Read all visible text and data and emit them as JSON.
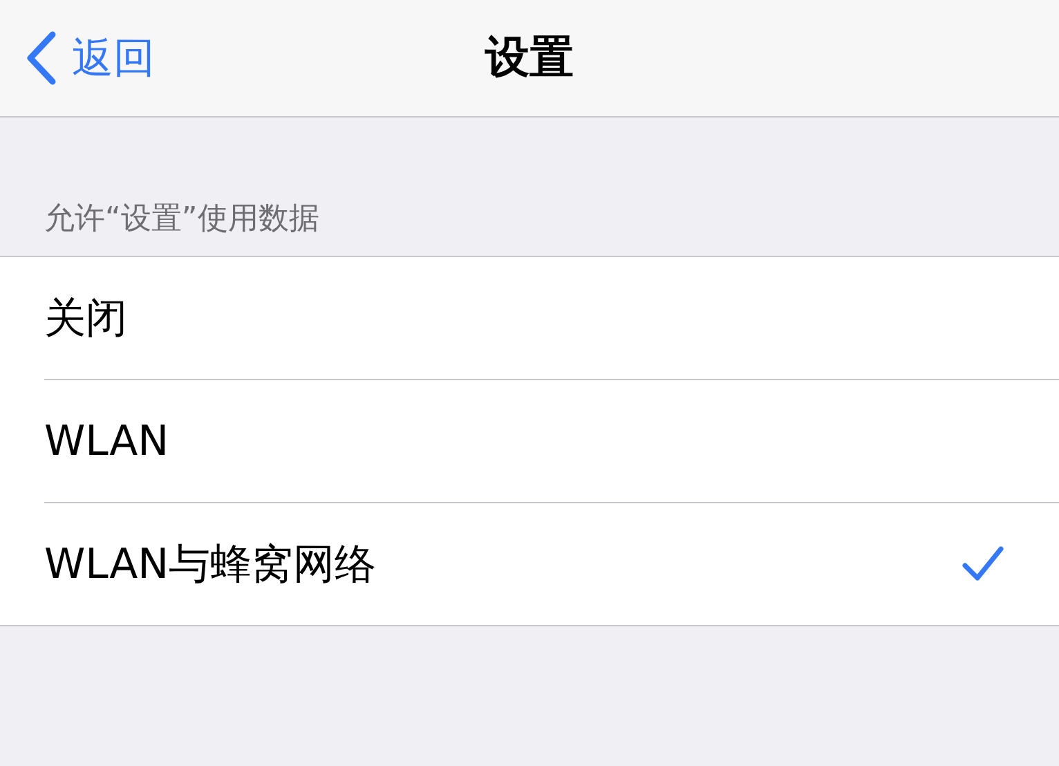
{
  "nav_bar": {
    "back_label": "返回",
    "title": "设置"
  },
  "section": {
    "header": "允许“设置”使用数据",
    "options": [
      {
        "label": "关闭",
        "selected": false
      },
      {
        "label": "WLAN",
        "selected": false
      },
      {
        "label": "WLAN与蜂窝网络",
        "selected": true
      }
    ]
  }
}
